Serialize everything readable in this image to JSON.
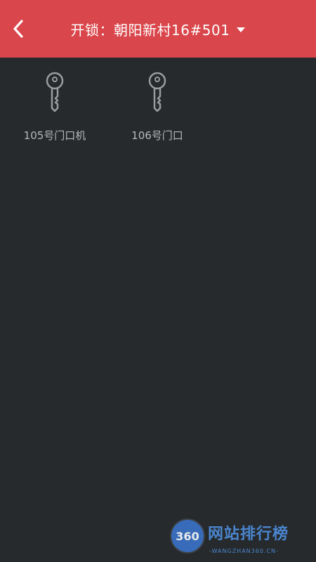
{
  "header": {
    "title": "开锁：朝阳新村16#501",
    "back_icon": "chevron-left-icon",
    "dropdown_icon": "caret-down-icon",
    "background_color": "#d9464b"
  },
  "locks": [
    {
      "label": "105号门口机",
      "icon": "key-icon"
    },
    {
      "label": "106号门口",
      "icon": "key-icon"
    }
  ],
  "watermark": {
    "logo": "360",
    "text": "网站排行榜",
    "subtext": "-WANGZHAN360.CN-"
  },
  "colors": {
    "page_background": "#262a2c",
    "label_text": "#b7b9bb",
    "icon_stroke": "#9a9c9e"
  }
}
